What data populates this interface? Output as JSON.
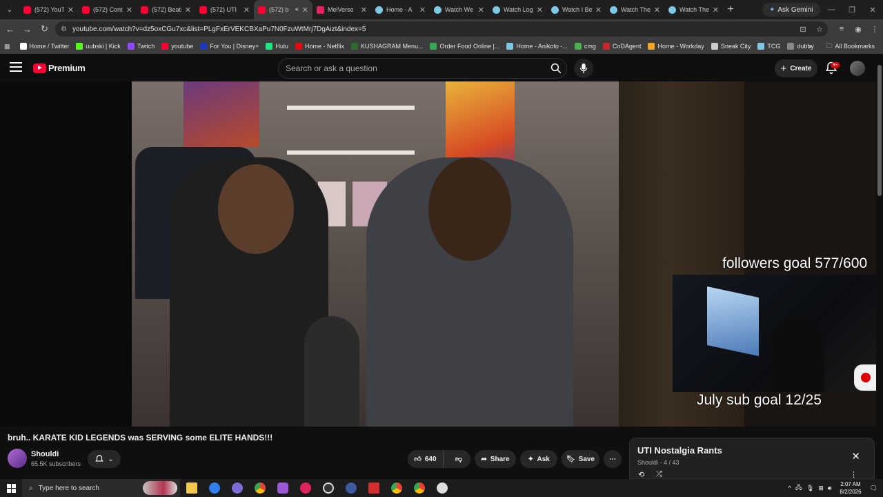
{
  "browser": {
    "tabs": [
      {
        "title": "(572) YouT",
        "icon": "youtube-icon",
        "active": false
      },
      {
        "title": "(572) Cont",
        "icon": "youtube-icon",
        "active": false
      },
      {
        "title": "(572) Beati",
        "icon": "youtube-icon",
        "active": false
      },
      {
        "title": "(572) UTI",
        "icon": "youtube-icon",
        "active": false
      },
      {
        "title": "(572) b",
        "icon": "youtube-icon",
        "active": true
      },
      {
        "title": "MelVerse",
        "icon": "melverse-icon",
        "active": false
      },
      {
        "title": "Home - A",
        "icon": "globe-icon",
        "active": false
      },
      {
        "title": "Watch We",
        "icon": "globe-icon",
        "active": false
      },
      {
        "title": "Watch Log",
        "icon": "globe-icon",
        "active": false
      },
      {
        "title": "Watch I Be",
        "icon": "globe-icon",
        "active": false
      },
      {
        "title": "Watch The",
        "icon": "globe-icon",
        "active": false
      },
      {
        "title": "Watch The",
        "icon": "globe-icon",
        "active": false
      }
    ],
    "new_tab": "+",
    "ask_gemini": "Ask Gemini",
    "url": "youtube.com/watch?v=dz5oxCGu7xc&list=PLgFxErVEKCBXaPu7N0FzuWtMrj7DgAizt&index=5",
    "bookmarks": [
      {
        "label": "Home / Twitter",
        "color": "#ffffff"
      },
      {
        "label": "uubski | Kick",
        "color": "#53fc18"
      },
      {
        "label": "Twitch",
        "color": "#9146ff"
      },
      {
        "label": "youtube",
        "color": "#ff0033"
      },
      {
        "label": "For You | Disney+",
        "color": "#1a3bbf"
      },
      {
        "label": "Hulu",
        "color": "#1ce783"
      },
      {
        "label": "Home - Netflix",
        "color": "#e50914"
      },
      {
        "label": "KUSHAGRAM Menu...",
        "color": "#2e6b2e"
      },
      {
        "label": "Order Food Online |...",
        "color": "#34a853"
      },
      {
        "label": "Home - Anikoto -...",
        "color": "#7ec8e3"
      },
      {
        "label": "cmg",
        "color": "#4caf50"
      },
      {
        "label": "CoDAgent",
        "color": "#c62828"
      },
      {
        "label": "Home - Workday",
        "color": "#f5a623"
      },
      {
        "label": "Sneak City",
        "color": "#cccccc"
      },
      {
        "label": "TCG",
        "color": "#7ec8e3"
      },
      {
        "label": "dubby",
        "color": "#888888"
      }
    ],
    "all_bookmarks": "All Bookmarks"
  },
  "youtube": {
    "logo_text": "Premium",
    "search_placeholder": "Search or ask a question",
    "create_label": "Create",
    "notif_badge": "9+"
  },
  "video": {
    "overlay_followers": "followers goal 577/600",
    "overlay_sub": "July sub goal 12/25",
    "title": "bruh.. KARATE KID LEGENDS was SERVING some ELITE HANDS!!!",
    "channel": "Shouldi",
    "subscribers": "65.5K subscribers",
    "likes": "640",
    "share": "Share",
    "ask": "Ask",
    "save": "Save"
  },
  "playlist": {
    "title": "UTI Nostalgia Rants",
    "channel": "Shouldi",
    "position": "4 / 43"
  },
  "taskbar": {
    "search_placeholder": "Type here to search",
    "time": "2:07 AM",
    "date": "8/2/2026"
  }
}
